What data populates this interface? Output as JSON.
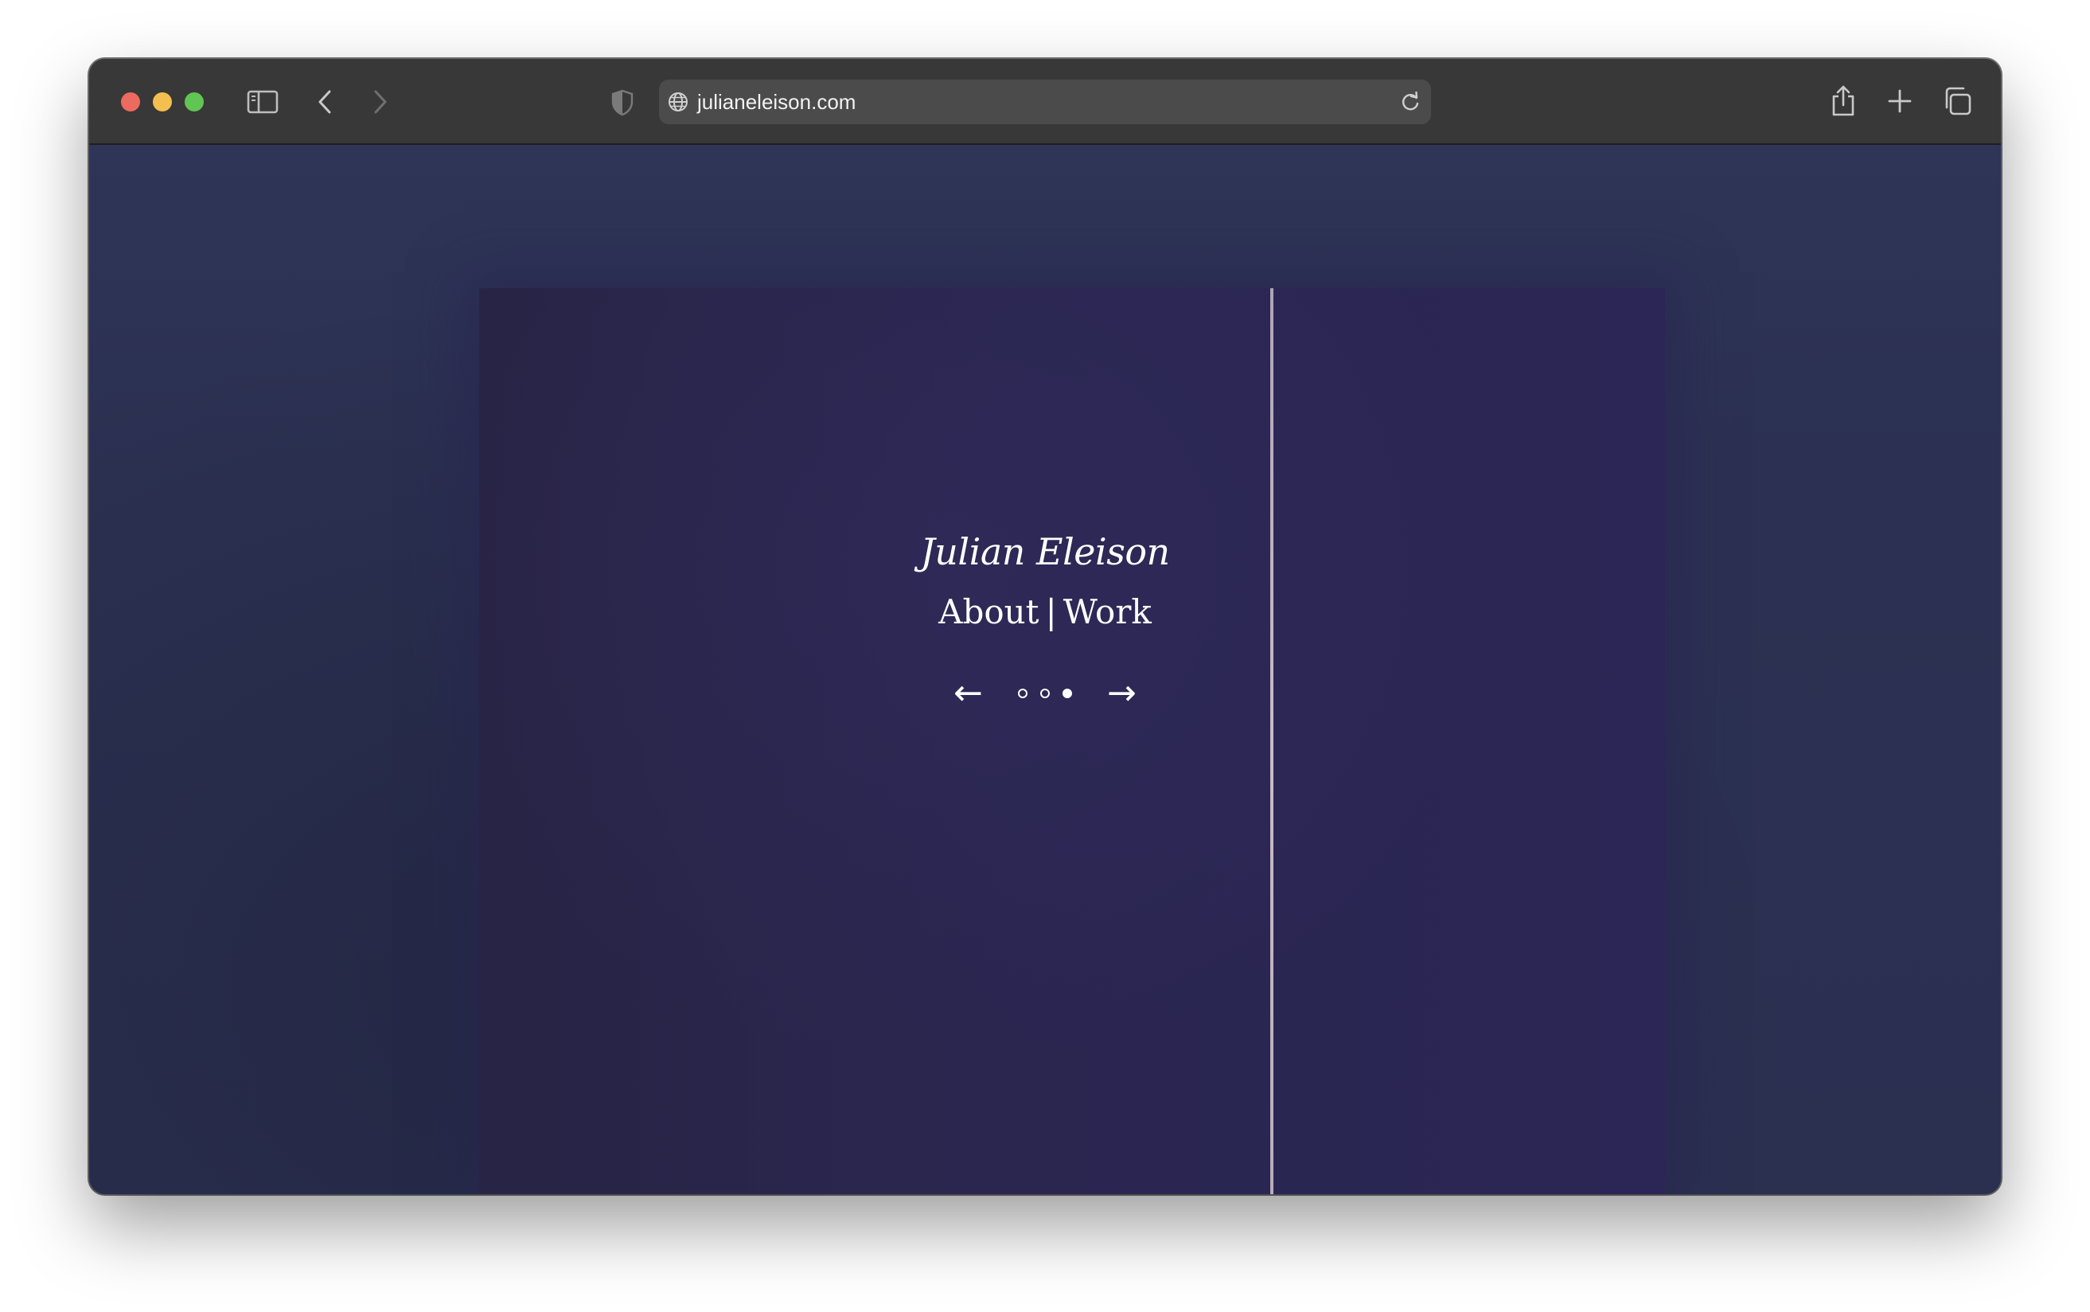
{
  "browser": {
    "url": "julianeleison.com"
  },
  "page": {
    "site_title": "Julian Eleison",
    "nav": [
      {
        "label": "About"
      },
      {
        "label": "Work"
      }
    ],
    "nav_separator": "|",
    "carousel": {
      "prev_arrow": "←",
      "next_arrow": "→",
      "slide_count": 3,
      "active_slide": 3
    }
  },
  "colors": {
    "background": "#2c3153",
    "text": "#ffffff",
    "toolbar": "#383838"
  },
  "icons": [
    "sidebar-icon",
    "back-icon",
    "forward-icon",
    "shield-icon",
    "globe-icon",
    "reload-icon",
    "share-icon",
    "new-tab-icon",
    "tabs-overview-icon"
  ]
}
